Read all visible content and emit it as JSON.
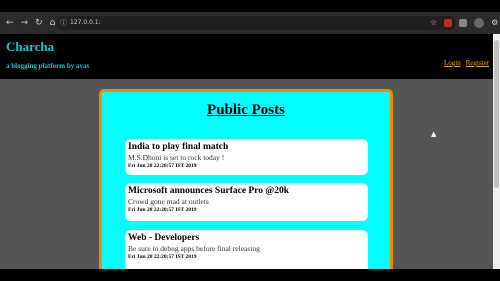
{
  "browser": {
    "url": "127.0.0.1:",
    "nav_icons": [
      "←",
      "→",
      "↻",
      "⌂"
    ],
    "url_info_icon": "ⓘ",
    "right_icons": [
      "☆",
      "⚙"
    ]
  },
  "header": {
    "brand": "Charcha",
    "tagline": "a blogging platform by avas",
    "login_label": "Login",
    "register_label": "Register"
  },
  "panel": {
    "title": "Public Posts",
    "posts": [
      {
        "title": "India to play final match",
        "body": "M.S.Dhoni is set to rock today !",
        "timestamp": "Fri Jun 28 22:20:57 IST 2019"
      },
      {
        "title": "Microsoft announces Surface Pro @20k",
        "body": "Crowd gone mad at outlets",
        "timestamp": "Fri Jun 28 22:20:57 IST 2019"
      },
      {
        "title": "Web - Developers",
        "body": "Be sure to debug apps before final releasing",
        "timestamp": "Fri Jun 28 22:20:57 IST 2019"
      }
    ]
  },
  "colors": {
    "brand": "#20c8c8",
    "link": "#e2a533",
    "panel_bg": "#00ffff",
    "panel_border": "#f08c00",
    "page_bg": "#555555"
  }
}
